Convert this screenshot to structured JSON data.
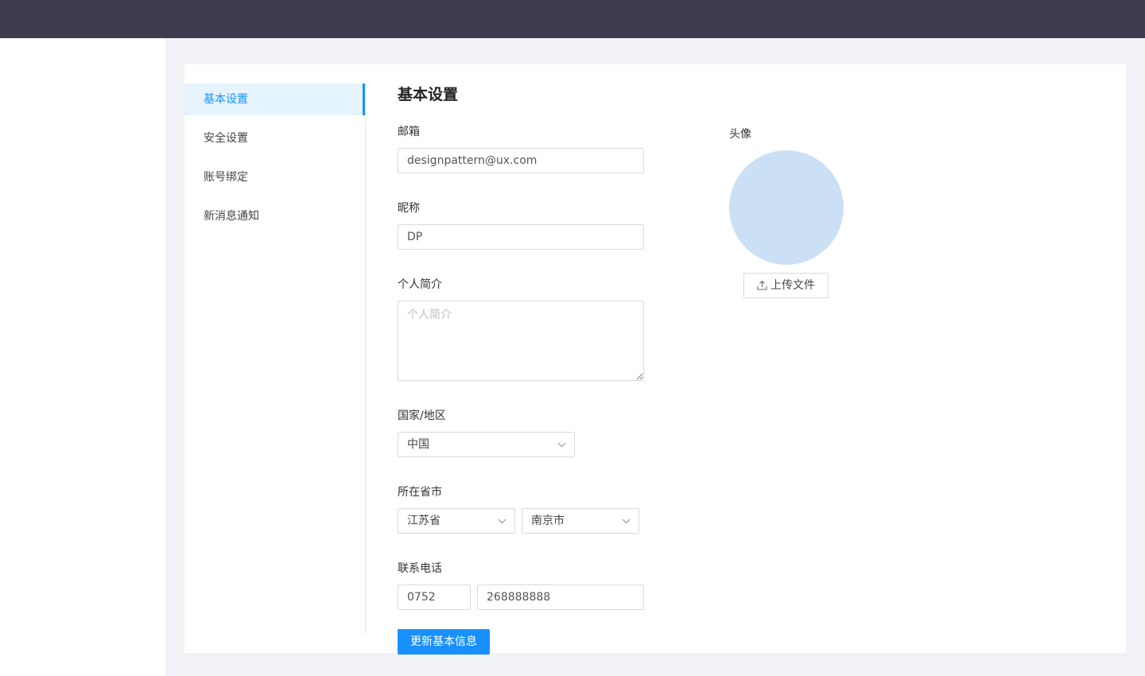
{
  "menu": {
    "items": [
      {
        "label": "基本设置",
        "active": true
      },
      {
        "label": "安全设置",
        "active": false
      },
      {
        "label": "账号绑定",
        "active": false
      },
      {
        "label": "新消息通知",
        "active": false
      }
    ]
  },
  "form": {
    "title": "基本设置",
    "email": {
      "label": "邮箱",
      "value": "designpattern@ux.com"
    },
    "nickname": {
      "label": "昵称",
      "value": "DP"
    },
    "bio": {
      "label": "个人简介",
      "placeholder": "个人简介",
      "value": ""
    },
    "country": {
      "label": "国家/地区",
      "selected": "中国"
    },
    "region": {
      "label": "所在省市",
      "province": "江苏省",
      "city": "南京市"
    },
    "phone": {
      "label": "联系电话",
      "area_code": "0752",
      "number": "268888888"
    },
    "submit_label": "更新基本信息"
  },
  "avatar": {
    "label": "头像",
    "upload_label": "上传文件",
    "color": "#cce0f5"
  },
  "colors": {
    "topbar": "#3e3d4f",
    "accent": "#1890ff",
    "page_bg": "#f0f2f5"
  }
}
